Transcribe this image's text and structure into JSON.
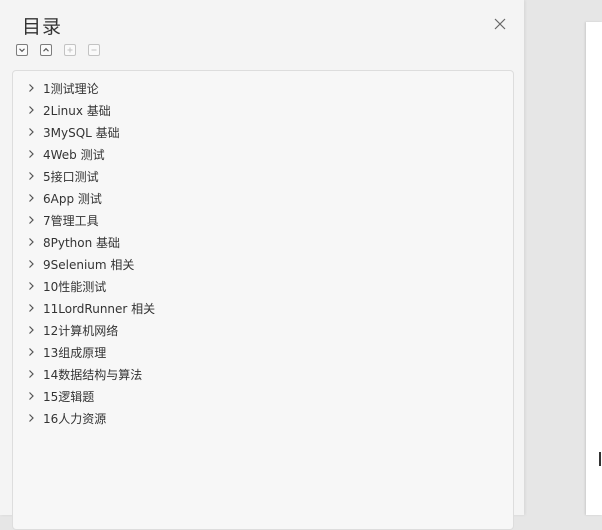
{
  "panel": {
    "title": "目录"
  },
  "toolbar": {
    "expand_icon": "chevron-down-icon",
    "collapse_icon": "chevron-up-icon",
    "add_icon": "plus-icon",
    "remove_icon": "minus-icon"
  },
  "colors": {
    "panel_bg": "#f4f4f4",
    "tree_bg": "#f7f7f7",
    "text": "#333333",
    "icon": "#555555"
  },
  "toc": {
    "items": [
      {
        "label": "1测试理论"
      },
      {
        "label": "2Linux 基础"
      },
      {
        "label": "3MySQL 基础"
      },
      {
        "label": "4Web 测试"
      },
      {
        "label": "5接口测试"
      },
      {
        "label": "6App  测试"
      },
      {
        "label": "7管理工具"
      },
      {
        "label": "8Python  基础"
      },
      {
        "label": "9Selenium  相关"
      },
      {
        "label": "10性能测试"
      },
      {
        "label": "11LordRunner 相关"
      },
      {
        "label": "12计算机网络"
      },
      {
        "label": "13组成原理"
      },
      {
        "label": "14数据结构与算法"
      },
      {
        "label": "15逻辑题"
      },
      {
        "label": "16人力资源"
      }
    ]
  }
}
